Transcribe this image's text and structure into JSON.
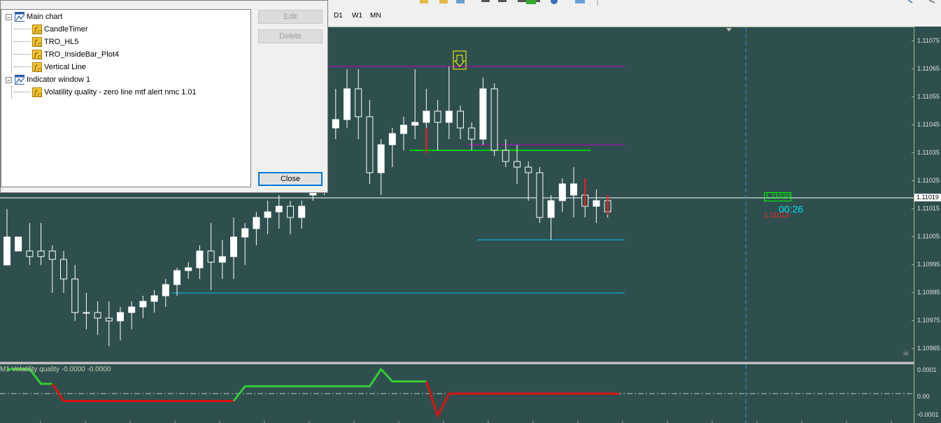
{
  "toolbar": {
    "timeframes": [
      "D1",
      "W1",
      "MN"
    ]
  },
  "dialog": {
    "tree": [
      {
        "label": "Main chart",
        "level": 0,
        "type": "window",
        "expanded": true
      },
      {
        "label": "CandleTimer",
        "level": 1,
        "type": "indicator"
      },
      {
        "label": "TRO_HL5",
        "level": 1,
        "type": "indicator"
      },
      {
        "label": "TRO_InsideBar_Plot4",
        "level": 1,
        "type": "indicator"
      },
      {
        "label": "Vertical Line",
        "level": 1,
        "type": "indicator"
      },
      {
        "label": "Indicator window 1",
        "level": 0,
        "type": "window",
        "expanded": true
      },
      {
        "label": "Volatility quality - zero line mtf alert nmc 1.01",
        "level": 1,
        "type": "indicator"
      }
    ],
    "buttons": {
      "edit": "Edit",
      "delete": "Delete",
      "close": "Close"
    }
  },
  "chart": {
    "timer": "00:26",
    "tag_high": "1.11020",
    "tag_low": "1.11013",
    "subwindow_label": "M1 Volatility quality -0.0000 -0.0000",
    "price_labels": [
      "1.11075",
      "1.11065",
      "1.11055",
      "1.11045",
      "1.11035",
      "1.11025",
      "1.11015",
      "1.11005",
      "1.10995",
      "1.10985",
      "1.10975",
      "1.10965"
    ],
    "current_price": "1.11019",
    "sub_labels": [
      "0.0001",
      "0.00",
      "-0.0001"
    ]
  },
  "chart_data": {
    "type": "candlestick",
    "ylim": [
      1.1096,
      1.1108
    ],
    "candles": [
      [
        1.10995,
        1.11015,
        1.11,
        1.11005,
        "bull"
      ],
      [
        1.11005,
        1.11035,
        1.1103,
        1.11,
        "bull"
      ],
      [
        1.11,
        1.1101,
        1.10995,
        1.10998,
        "bear"
      ],
      [
        1.10998,
        1.1101,
        1.10995,
        1.11,
        "bear"
      ],
      [
        1.11,
        1.11002,
        1.10985,
        1.10997,
        "bear"
      ],
      [
        1.10997,
        1.11,
        1.10985,
        1.1099,
        "bear"
      ],
      [
        1.1099,
        1.10995,
        1.10975,
        1.10978,
        "bear"
      ],
      [
        1.10978,
        1.10985,
        1.10972,
        1.10978,
        "bull"
      ],
      [
        1.10978,
        1.10982,
        1.1097,
        1.10976,
        "bear"
      ],
      [
        1.10976,
        1.10982,
        1.10966,
        1.10975,
        "bear"
      ],
      [
        1.10975,
        1.1098,
        1.10968,
        1.10978,
        "bull"
      ],
      [
        1.10978,
        1.10982,
        1.10972,
        1.1098,
        "bull"
      ],
      [
        1.1098,
        1.10984,
        1.10976,
        1.10982,
        "bull"
      ],
      [
        1.10982,
        1.10986,
        1.10978,
        1.10984,
        "bull"
      ],
      [
        1.10984,
        1.1099,
        1.1098,
        1.10988,
        "bull"
      ],
      [
        1.10988,
        1.10994,
        1.10984,
        1.10993,
        "bull"
      ],
      [
        1.10993,
        1.10996,
        1.1099,
        1.10994,
        "bull"
      ],
      [
        1.10994,
        1.11002,
        1.1099,
        1.11,
        "bull"
      ],
      [
        1.11,
        1.1101,
        1.10986,
        1.10996,
        "bear"
      ],
      [
        1.10996,
        1.11004,
        1.1099,
        1.10998,
        "bull"
      ],
      [
        1.10998,
        1.11012,
        1.1099,
        1.11005,
        "bull"
      ],
      [
        1.11005,
        1.1101,
        1.10995,
        1.11008,
        "bull"
      ],
      [
        1.11008,
        1.11014,
        1.11002,
        1.11012,
        "bull"
      ],
      [
        1.11012,
        1.11018,
        1.11006,
        1.11014,
        "bull"
      ],
      [
        1.11014,
        1.1102,
        1.11008,
        1.11016,
        "bull"
      ],
      [
        1.11016,
        1.11018,
        1.11006,
        1.11012,
        "bear"
      ],
      [
        1.11012,
        1.11018,
        1.11008,
        1.11016,
        "bull"
      ],
      [
        1.1102,
        1.1103,
        1.11018,
        1.11022,
        "bull"
      ],
      [
        1.11022,
        1.11046,
        1.1102,
        1.11044,
        "bull"
      ],
      [
        1.11044,
        1.11058,
        1.1104,
        1.11047,
        "bull"
      ],
      [
        1.11047,
        1.11065,
        1.11044,
        1.11058,
        "bull"
      ],
      [
        1.11058,
        1.11065,
        1.1104,
        1.11048,
        "bear"
      ],
      [
        1.11048,
        1.11054,
        1.11024,
        1.11028,
        "bear"
      ],
      [
        1.11028,
        1.1104,
        1.1102,
        1.11038,
        "bull"
      ],
      [
        1.11038,
        1.11044,
        1.1103,
        1.11042,
        "bull"
      ],
      [
        1.11042,
        1.11048,
        1.11036,
        1.11045,
        "bull"
      ],
      [
        1.11045,
        1.11065,
        1.1104,
        1.11046,
        "bull"
      ],
      [
        1.11046,
        1.11058,
        1.1104,
        1.1105,
        "bull"
      ],
      [
        1.1105,
        1.11054,
        1.11036,
        1.11046,
        "bear"
      ],
      [
        1.11046,
        1.11066,
        1.1104,
        1.1105,
        "bull"
      ],
      [
        1.1105,
        1.11052,
        1.1104,
        1.11044,
        "bear"
      ],
      [
        1.11044,
        1.11046,
        1.11036,
        1.1104,
        "bear"
      ],
      [
        1.1104,
        1.11062,
        1.11038,
        1.11058,
        "bull"
      ],
      [
        1.11058,
        1.1106,
        1.11034,
        1.11036,
        "bear"
      ],
      [
        1.11036,
        1.1104,
        1.1103,
        1.11032,
        "bear"
      ],
      [
        1.11032,
        1.11038,
        1.11024,
        1.1103,
        "bear"
      ],
      [
        1.1103,
        1.11032,
        1.11018,
        1.11028,
        "bear"
      ],
      [
        1.11028,
        1.1103,
        1.1101,
        1.11012,
        "bear"
      ],
      [
        1.11012,
        1.1102,
        1.11004,
        1.11018,
        "bull"
      ],
      [
        1.11018,
        1.11026,
        1.11014,
        1.11024,
        "bull"
      ],
      [
        1.11024,
        1.1103,
        1.11012,
        1.1102,
        "bull"
      ],
      [
        1.1102,
        1.11024,
        1.11012,
        1.11016,
        "bear"
      ],
      [
        1.11016,
        1.11022,
        1.1101,
        1.11018,
        "bull"
      ],
      [
        1.11018,
        1.1102,
        1.11012,
        1.11014,
        "bear"
      ]
    ],
    "red_marks": [
      {
        "index": 37,
        "high": 1.11044,
        "low": 1.11035
      },
      {
        "index": 51,
        "high": 1.11026,
        "low": 1.11016
      },
      {
        "index": 53,
        "high": 1.1102,
        "low": 1.11013
      }
    ],
    "levels": [
      {
        "price": 1.11066,
        "color": "#c000c0",
        "from_index": 16,
        "to_index": 54
      },
      {
        "price": 1.11038,
        "color": "#c000c0",
        "from_index": 41,
        "to_index": 54
      },
      {
        "price": 1.11036,
        "color": "#00cc00",
        "from_index": 36,
        "to_index": 51
      },
      {
        "price": 1.11004,
        "color": "#00c0e0",
        "from_index": 42,
        "to_index": 54
      },
      {
        "price": 1.10985,
        "color": "#00c0e0",
        "from_index": 15,
        "to_index": 54
      }
    ],
    "current_price": 1.11019,
    "indicator": {
      "ylim": [
        -0.00012,
        0.00012
      ],
      "segments": [
        {
          "color": "#33cc33",
          "points": [
            [
              0,
              0.0001
            ],
            [
              2,
              0.0001
            ],
            [
              3,
              4e-05
            ],
            [
              4,
              4e-05
            ]
          ]
        },
        {
          "color": "#dd1111",
          "points": [
            [
              4,
              4e-05
            ],
            [
              5,
              -3e-05
            ],
            [
              20,
              -3e-05
            ]
          ]
        },
        {
          "color": "#33cc33",
          "points": [
            [
              20,
              -3e-05
            ],
            [
              21,
              3e-05
            ],
            [
              32,
              3e-05
            ],
            [
              33,
              0.0001
            ],
            [
              34,
              5e-05
            ],
            [
              37,
              5e-05
            ]
          ]
        },
        {
          "color": "#dd1111",
          "points": [
            [
              37,
              5e-05
            ],
            [
              38,
              -9e-05
            ],
            [
              39,
              0.0
            ],
            [
              54,
              0.0
            ]
          ]
        }
      ]
    }
  },
  "colors": {
    "background": "#2f4f4f",
    "bull": "#ffffff",
    "bear": "#2f4f4f",
    "wick": "#ffffff",
    "grid_line": "#a9b98a",
    "price_line": "#ffffff"
  }
}
